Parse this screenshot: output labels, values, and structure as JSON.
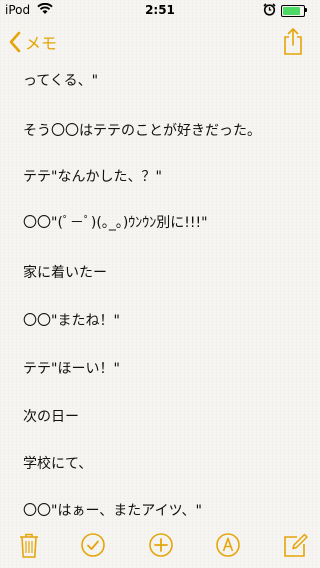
{
  "status_bar": {
    "carrier": "iPod",
    "time": "2:51",
    "battery_level": 0.85,
    "icons": [
      "wifi-icon",
      "alarm-icon",
      "battery-icon"
    ]
  },
  "nav": {
    "back_label": "メモ",
    "back_icon": "chevron-left-icon",
    "share_icon": "share-icon"
  },
  "note": {
    "lines": [
      "ってくる、\"",
      "そう〇〇はテテのことが好きだった。",
      "テテ\"なんかした、？\"",
      "〇〇\"(ﾟ－ﾟ)(｡_｡)ｳﾝｳﾝ別に!!!\"",
      "家に着いたー",
      "〇〇\"またね！\"",
      "テテ\"ほーい！\"",
      "次の日ー",
      "学校にて、",
      "〇〇\"はぁー、またアイツ、\""
    ]
  },
  "toolbar": {
    "icons": [
      "trash-icon",
      "checklist-icon",
      "add-icon",
      "markup-icon",
      "compose-icon"
    ]
  },
  "colors": {
    "accent": "#e5a50a",
    "background": "#f6f5f1",
    "battery": "#4cd964"
  }
}
